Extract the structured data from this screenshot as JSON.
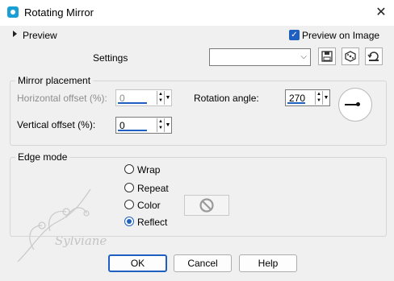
{
  "window": {
    "title": "Rotating Mirror",
    "close_glyph": "✕",
    "icon": "app-icon"
  },
  "preview": {
    "toggle_label": "Preview",
    "preview_on_image_label": "Preview on Image",
    "preview_on_image_checked": true
  },
  "settings": {
    "label": "Settings",
    "value": "",
    "icons": [
      "save-icon",
      "randomize-icon",
      "reset-icon"
    ]
  },
  "mirror_placement": {
    "legend": "Mirror placement",
    "horizontal_offset_label": "Horizontal offset (%):",
    "horizontal_offset_value": "0",
    "horizontal_offset_enabled": false,
    "vertical_offset_label": "Vertical offset (%):",
    "vertical_offset_value": "0",
    "rotation_angle_label": "Rotation angle:",
    "rotation_angle_value": "270"
  },
  "edge_mode": {
    "legend": "Edge mode",
    "options": [
      "Wrap",
      "Repeat",
      "Color",
      "Reflect"
    ],
    "selected": "Reflect",
    "color_swatch_icon": "no-color-icon"
  },
  "buttons": {
    "ok": "OK",
    "cancel": "Cancel",
    "help": "Help"
  },
  "watermark": {
    "text": "Sylviane"
  },
  "colors": {
    "accent": "#1f5fbf",
    "background": "#f0f0f0"
  }
}
